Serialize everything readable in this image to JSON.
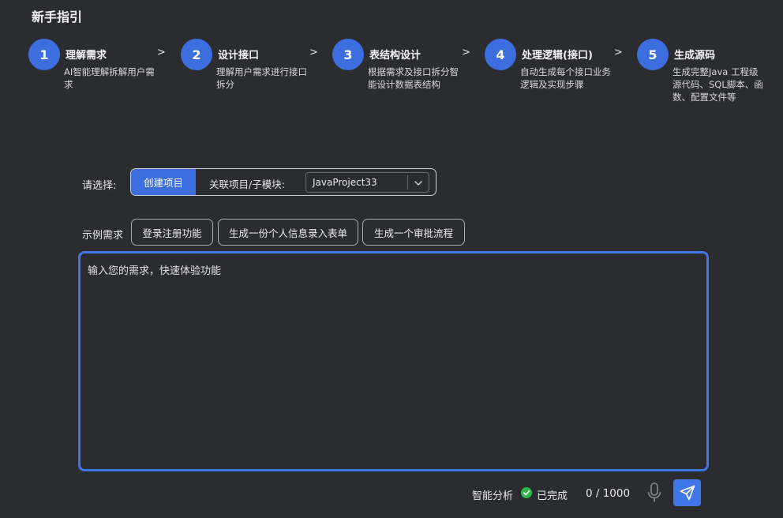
{
  "page": {
    "title": "新手指引"
  },
  "steps": [
    {
      "num": "1",
      "name": "理解需求",
      "desc": "AI智能理解拆解用户需求"
    },
    {
      "num": "2",
      "name": "设计接口",
      "desc": "理解用户需求进行接口拆分"
    },
    {
      "num": "3",
      "name": "表结构设计",
      "desc": "根据需求及接口拆分智能设计数据表结构"
    },
    {
      "num": "4",
      "name": "处理逻辑(接口)",
      "desc": "自动生成每个接口业务逻辑及实现步骤"
    },
    {
      "num": "5",
      "name": "生成源码",
      "desc": "生成完整Java 工程级源代码、SQL脚本、函数、配置文件等"
    }
  ],
  "step_separator": ">",
  "selector": {
    "label": "请选择:",
    "create_button": "创建项目",
    "assoc_label": "关联项目/子模块:",
    "project_value": "JavaProject33"
  },
  "examples": {
    "label": "示例需求",
    "chips": [
      "登录注册功能",
      "生成一份个人信息录入表单",
      "生成一个审批流程"
    ]
  },
  "input": {
    "placeholder": "输入您的需求，快速体验功能"
  },
  "footer": {
    "analysis_label": "智能分析",
    "status": "已完成",
    "counter": "0 / 1000"
  },
  "icons": {
    "check": "check-circle-icon",
    "mic": "microphone-icon",
    "send": "send-icon",
    "chevron": "chevron-down-icon"
  },
  "colors": {
    "accent": "#3d6ee0",
    "background": "#2b2c30",
    "success": "#2fb84a"
  }
}
